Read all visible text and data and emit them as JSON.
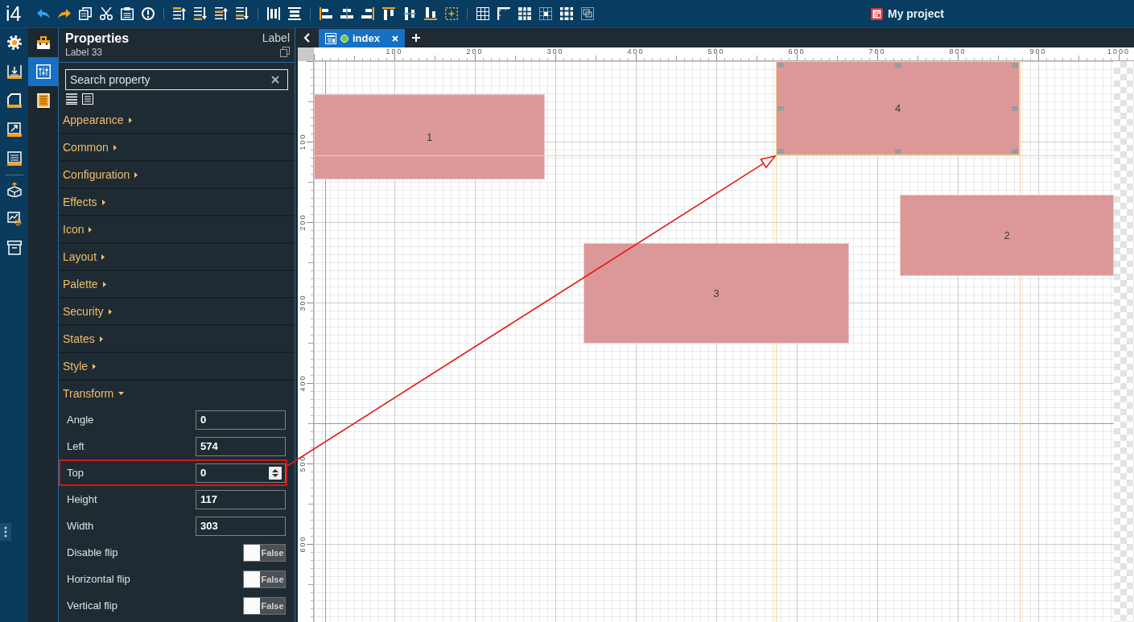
{
  "app": {
    "logo": "i4",
    "project": "My project"
  },
  "side_tabs": [
    {
      "selected": false
    },
    {
      "selected": true
    },
    {
      "selected": false
    }
  ],
  "properties": {
    "title": "Properties",
    "element": "Label 33",
    "type": "Label",
    "search": {
      "placeholder": "Search property"
    },
    "categories": [
      {
        "label": "Appearance",
        "expanded": false
      },
      {
        "label": "Common",
        "expanded": false
      },
      {
        "label": "Configuration",
        "expanded": false
      },
      {
        "label": "Effects",
        "expanded": false
      },
      {
        "label": "Icon",
        "expanded": false
      },
      {
        "label": "Layout",
        "expanded": false
      },
      {
        "label": "Palette",
        "expanded": false
      },
      {
        "label": "Security",
        "expanded": false
      },
      {
        "label": "States",
        "expanded": false
      },
      {
        "label": "Style",
        "expanded": false
      },
      {
        "label": "Transform",
        "expanded": true,
        "fields": [
          {
            "label": "Angle",
            "kind": "number",
            "value": "0",
            "focused": false,
            "highlighted": false
          },
          {
            "label": "Left",
            "kind": "number",
            "value": "574",
            "focused": false,
            "highlighted": false
          },
          {
            "label": "Top",
            "kind": "number",
            "value": "0",
            "focused": true,
            "highlighted": true
          },
          {
            "label": "Height",
            "kind": "number",
            "value": "117",
            "focused": false,
            "highlighted": false
          },
          {
            "label": "Width",
            "kind": "number",
            "value": "303",
            "focused": false,
            "highlighted": false
          },
          {
            "label": "Disable flip",
            "kind": "toggle",
            "value": "False",
            "on": false,
            "highlighted": false
          },
          {
            "label": "Horizontal flip",
            "kind": "toggle",
            "value": "False",
            "on": false,
            "highlighted": false
          },
          {
            "label": "Vertical flip",
            "kind": "toggle",
            "value": "False",
            "on": false,
            "highlighted": false
          }
        ]
      }
    ]
  },
  "tabs": [
    {
      "label": "index",
      "selected": true
    }
  ],
  "rulers": {
    "horizontal": [
      "100",
      "200",
      "300",
      "400",
      "500",
      "600",
      "700",
      "800",
      "900",
      "1000"
    ],
    "vertical": [
      "100",
      "200",
      "300",
      "400",
      "500",
      "600"
    ]
  },
  "widgets": [
    {
      "label": "1",
      "selected": false
    },
    {
      "label": "4",
      "selected": true
    },
    {
      "label": "2",
      "selected": false
    },
    {
      "label": "3",
      "selected": false
    }
  ]
}
